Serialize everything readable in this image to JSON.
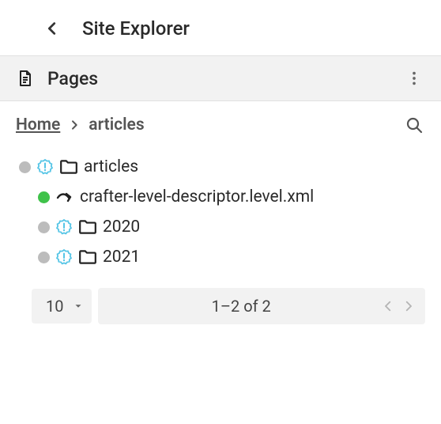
{
  "header": {
    "title": "Site Explorer"
  },
  "section": {
    "title": "Pages"
  },
  "breadcrumb": {
    "home": "Home",
    "current": "articles"
  },
  "tree": {
    "root": {
      "label": "articles",
      "status": "gray",
      "badge": "new"
    },
    "children": [
      {
        "label": "crafter-level-descriptor.level.xml",
        "status": "green",
        "type": "level-descriptor"
      },
      {
        "label": "2020",
        "status": "gray",
        "badge": "new",
        "type": "folder"
      },
      {
        "label": "2021",
        "status": "gray",
        "badge": "new",
        "type": "folder"
      }
    ]
  },
  "pagination": {
    "pageSize": "10",
    "range": "1–2 of 2"
  }
}
